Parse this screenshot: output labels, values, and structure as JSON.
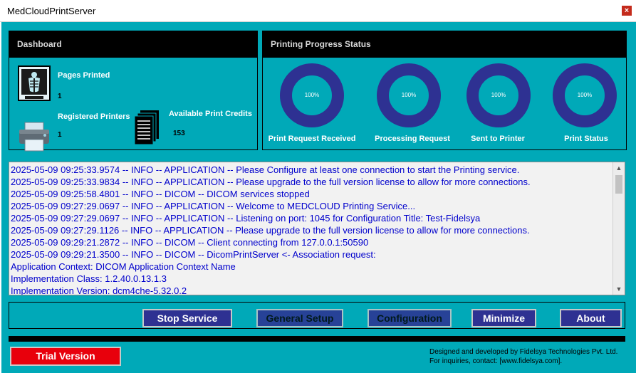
{
  "window": {
    "title": "MedCloudPrintServer",
    "close_glyph": "×"
  },
  "dashboard": {
    "title": "Dashboard",
    "pages_printed_label": "Pages Printed",
    "pages_printed_value": "1",
    "registered_printers_label": "Registered Printers",
    "registered_printers_value": "1",
    "credits_label": "Available Print Credits",
    "credits_value": "153"
  },
  "progress": {
    "title": "Printing Progress Status",
    "items": [
      {
        "label": "Print Request Received",
        "percent": "100%"
      },
      {
        "label": "Processing Request",
        "percent": "100%"
      },
      {
        "label": "Sent to Printer",
        "percent": "100%"
      },
      {
        "label": "Print Status",
        "percent": "100%"
      }
    ]
  },
  "log": {
    "lines": [
      "2025-05-09 09:25:33.9574 -- INFO -- APPLICATION -- Please Configure at least one connection to start the Printing service.",
      "2025-05-09 09:25:33.9834 -- INFO -- APPLICATION -- Please upgrade to the full version license to allow for more connections.",
      "2025-05-09 09:25:58.4801 -- INFO -- DICOM -- DICOM services stopped",
      "2025-05-09 09:27:29.0697 -- INFO -- APPLICATION -- Welcome to MEDCLOUD Printing Service...",
      "2025-05-09 09:27:29.0697 -- INFO -- APPLICATION -- Listening on port: 1045 for Configuration Title: Test-Fidelsya",
      "2025-05-09 09:27:29.1126 -- INFO -- APPLICATION -- Please upgrade to the full version license to allow for more connections.",
      "2025-05-09 09:29:21.2872 -- INFO -- DICOM -- Client connecting from 127.0.0.1:50590",
      "2025-05-09 09:29:21.3500 -- INFO -- DICOM -- DicomPrintServer <- Association request:",
      "Application Context:     DICOM Application Context Name",
      "Implementation Class:    1.2.40.0.13.1.3",
      "Implementation Version:  dcm4che-5.32.0.2"
    ]
  },
  "buttons": {
    "stop": "Stop Service",
    "general": "General Setup",
    "config": "Configuration",
    "minimize": "Minimize",
    "about": "About"
  },
  "trial": "Trial Version",
  "footer": {
    "line1": "Designed and developed by Fidelsya Technologies Pvt. Ltd.",
    "line2": "For inquiries, contact: [www.fidelsya.com]."
  },
  "colors": {
    "teal": "#00a9b8",
    "navy": "#2e3192",
    "log_text": "#0000cc",
    "trial_red": "#e8000c"
  }
}
